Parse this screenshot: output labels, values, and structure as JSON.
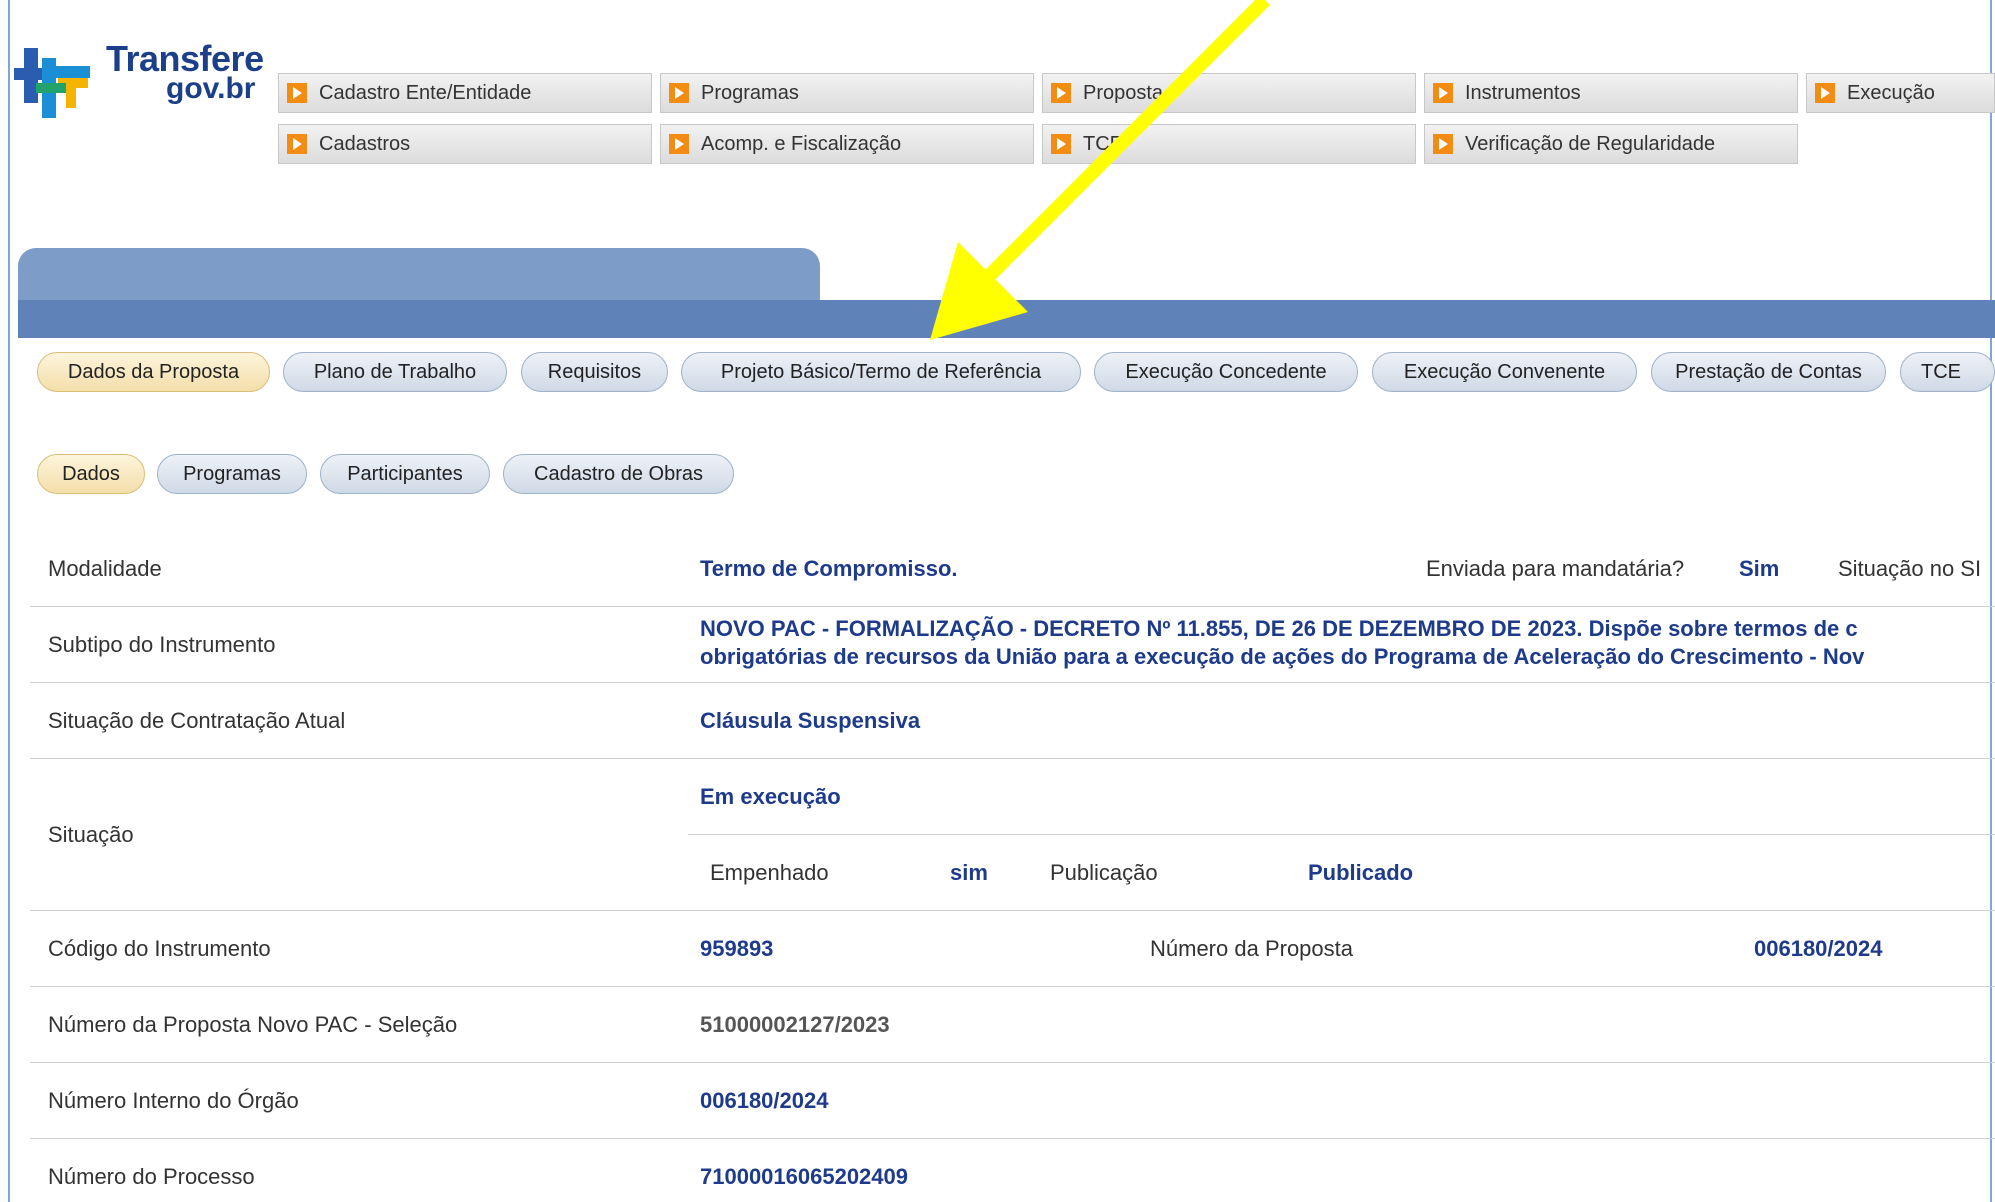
{
  "logo": {
    "line1": "Transfere",
    "line2": "gov.br"
  },
  "top_menu": {
    "row1": [
      "Cadastro Ente/Entidade",
      "Programas",
      "Proposta",
      "Instrumentos",
      "Execução"
    ],
    "row2": [
      "Cadastros",
      "Acomp. e Fiscalização",
      "TCE",
      "Verificação de Regularidade"
    ]
  },
  "main_tabs": [
    "Dados da Proposta",
    "Plano de Trabalho",
    "Requisitos",
    "Projeto Básico/Termo de Referência",
    "Execução Concedente",
    "Execução Convenente",
    "Prestação de Contas",
    "TCE"
  ],
  "sub_tabs": [
    "Dados",
    "Programas",
    "Participantes",
    "Cadastro de Obras"
  ],
  "fields": {
    "modalidade": {
      "label": "Modalidade",
      "value": "Termo de Compromisso.",
      "enviada_label": "Enviada para mandatária?",
      "enviada_value": "Sim",
      "situacao_si_label": "Situação no SI"
    },
    "subtipo": {
      "label": "Subtipo do Instrumento",
      "line1": "NOVO PAC - FORMALIZAÇÃO - DECRETO Nº 11.855, DE 26 DE DEZEMBRO DE 2023. Dispõe sobre termos de c",
      "line2": "obrigatórias de recursos da União para a execução de ações do Programa de Aceleração do Crescimento - Nov"
    },
    "situacao_contratacao": {
      "label": "Situação de Contratação Atual",
      "value": "Cláusula Suspensiva"
    },
    "situacao": {
      "label": "Situação",
      "value": "Em execução",
      "empenhado_label": "Empenhado",
      "empenhado_value": "sim",
      "publicacao_label": "Publicação",
      "publicacao_value": "Publicado"
    },
    "codigo": {
      "label": "Código do Instrumento",
      "value": "959893",
      "num_proposta_label": "Número da Proposta",
      "num_proposta_value": "006180/2024"
    },
    "novo_pac": {
      "label": "Número da Proposta Novo PAC - Seleção",
      "value": "51000002127/2023"
    },
    "interno": {
      "label": "Número Interno do Órgão",
      "value": "006180/2024"
    },
    "processo": {
      "label": "Número do Processo",
      "value": "71000016065202409"
    }
  },
  "colors": {
    "annotation_arrow": "#ffff00",
    "value_text": "#1d3b8a",
    "menu_arrow": "#f28c13",
    "band": "#5f83b9"
  }
}
